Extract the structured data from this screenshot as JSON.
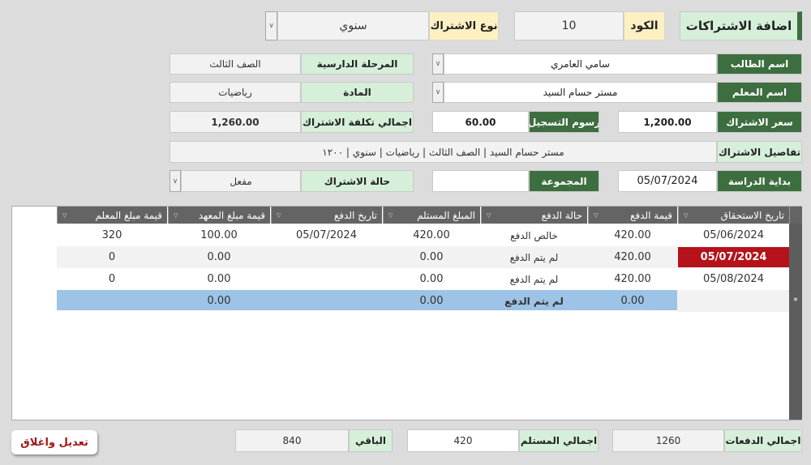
{
  "header": {
    "title": "اضافة الاشتراكات",
    "code_label": "الكود",
    "code_value": "10",
    "type_label": "نوع الاشتراك",
    "type_value": "سنوي"
  },
  "form": {
    "student_label": "اسم الطالب",
    "student_value": "سامي العامري",
    "stage_label": "المرحلة الدارسية",
    "stage_value": "الصف الثالث",
    "teacher_label": "اسم المعلم",
    "teacher_value": "مستر حسام السيد",
    "subject_label": "المادة",
    "subject_value": "رياضيات",
    "price_label": "سعر الاشتراك",
    "price_value": "1,200.00",
    "fee_label": "رسوم التسجيل",
    "fee_value": "60.00",
    "total_label": "اجمالي تكلفة الاشتراك",
    "total_value": "1,260.00",
    "details_label": "تفاصيل الاشتراك",
    "details_value": "مستر حسام السيد | الصف الثالث | رياضيات | سنوي |  ١٢٠٠",
    "start_label": "بداية الدراسة",
    "start_value": "05/07/2024",
    "group_label": "المجموعة",
    "group_value": "",
    "status_label": "حالة الاشتراك",
    "status_value": "مفعل"
  },
  "table": {
    "columns": [
      "تاريخ الاستحقاق",
      "قيمة الدفع",
      "حالة الدفع",
      "المبلغ المستلم",
      "تاريخ الدفع",
      "قيمة مبلغ المعهد",
      "قيمة مبلغ المعلم"
    ],
    "rows": [
      [
        "05/06/2024",
        "420.00",
        "خالص الدفع",
        "420.00",
        "05/07/2024",
        "100.00",
        "320"
      ],
      [
        "05/07/2024",
        "420.00",
        "لم يتم الدفع",
        "0.00",
        "",
        "0.00",
        "0"
      ],
      [
        "05/08/2024",
        "420.00",
        "لم يتم الدفع",
        "0.00",
        "",
        "0.00",
        "0"
      ],
      [
        "",
        "0.00",
        "لم يتم الدفع",
        "0.00",
        "",
        "0.00",
        ""
      ]
    ],
    "new_row_marker": "*",
    "highlight_color": "#b5121b",
    "new_row_color": "#9dc3e6"
  },
  "footer": {
    "total_payments_label": "اجمالي الدفعات",
    "total_payments_value": "1260",
    "received_label": "اجمالي المستلم",
    "received_value": "420",
    "remaining_label": "الباقي",
    "remaining_value": "840",
    "close_button": "تعديل واغلاق"
  }
}
